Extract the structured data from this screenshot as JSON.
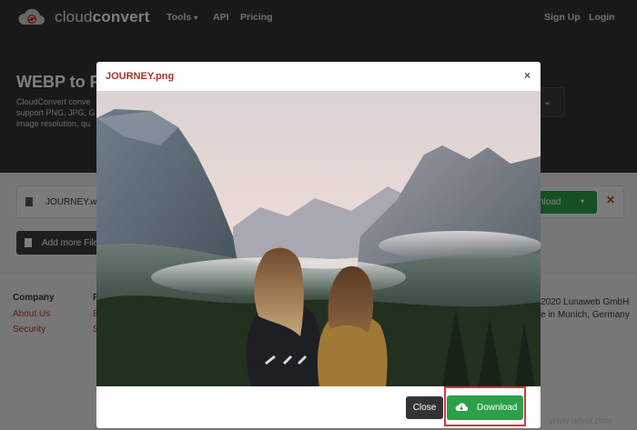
{
  "navbar": {
    "brand_light": "cloud",
    "brand_bold": "convert",
    "tools": "Tools",
    "api": "API",
    "pricing": "Pricing",
    "signup": "Sign Up",
    "login": "Login"
  },
  "hero": {
    "title": "WEBP to P",
    "desc_line1": "CloudConvert conve",
    "desc_line2": "support PNG, JPG, G",
    "desc_line3": "image resolution, qu"
  },
  "file_row": {
    "filename": "JOURNEY.wel",
    "download_label": "nload",
    "remove_icon": "close-icon"
  },
  "add_more": "Add more Files",
  "footer": {
    "company_heading": "Company",
    "about": "About Us",
    "security": "Security",
    "resources_heading": "R",
    "resources_link1": "E",
    "resources_link2": "S",
    "copyright": "2020 Lunaweb GmbH",
    "location": "e in Munich, Germany"
  },
  "modal": {
    "title": "JOURNEY.png",
    "close_x": "×",
    "close_button": "Close",
    "download_button": "Download"
  },
  "watermark": "www.wfvid.com",
  "colors": {
    "accent_green": "#2aa149",
    "brand_red": "#a93226",
    "dark": "#333335"
  }
}
